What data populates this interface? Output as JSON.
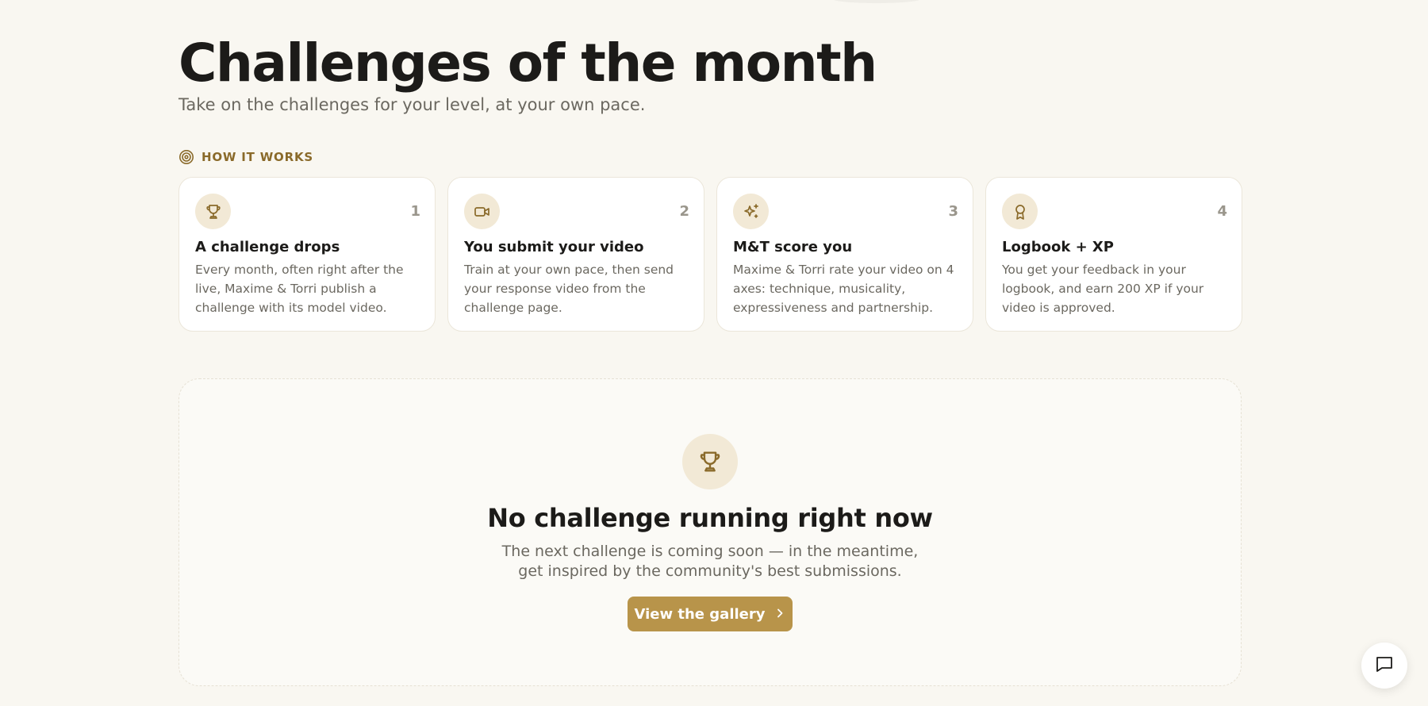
{
  "header": {
    "title": "Challenges of the month",
    "subtitle": "Take on the challenges for your level, at your own pace."
  },
  "how_it_works": {
    "label": "HOW IT WORKS",
    "icon": "target-icon",
    "steps": [
      {
        "number": "1",
        "icon": "trophy-icon",
        "title": "A challenge drops",
        "text": "Every month, often right after the live, Maxime & Torri publish a challenge with its model video."
      },
      {
        "number": "2",
        "icon": "video-icon",
        "title": "You submit your video",
        "text": "Train at your own pace, then send your response video from the challenge page."
      },
      {
        "number": "3",
        "icon": "sparkles-icon",
        "title": "M&T score you",
        "text": "Maxime & Torri rate your video on 4 axes: technique, musicality, expressiveness and partnership."
      },
      {
        "number": "4",
        "icon": "award-icon",
        "title": "Logbook + XP",
        "text": "You get your feedback in your logbook, and earn 200 XP if your video is approved."
      }
    ]
  },
  "empty_state": {
    "icon": "trophy-icon",
    "title": "No challenge running right now",
    "text": "The next challenge is coming soon — in the meantime, get inspired by the community's best submissions.",
    "button_label": "View the gallery"
  },
  "colors": {
    "background": "#f9f7f1",
    "accent": "#b8944a",
    "accent_dark": "#8a6a2a",
    "icon_bg": "#f2e9d6"
  },
  "chat_button": {
    "icon": "chat-icon"
  }
}
